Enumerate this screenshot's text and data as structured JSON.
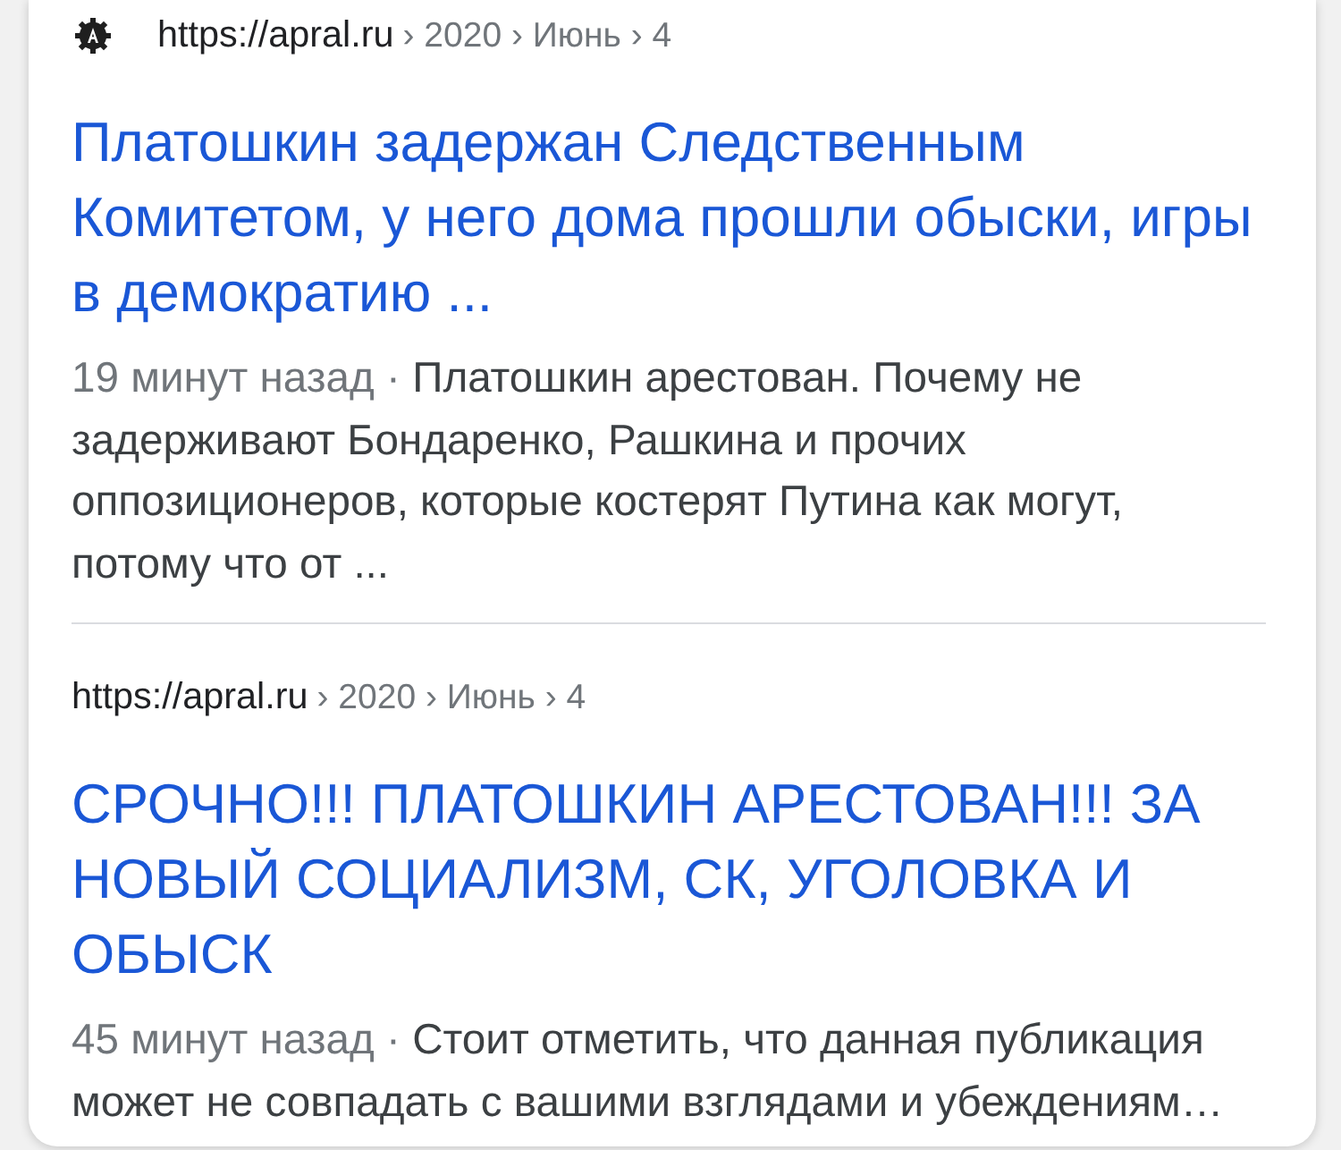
{
  "results": [
    {
      "favicon": true,
      "url": "https://apral.ru",
      "path": "› 2020 › Июнь › 4",
      "title": "Платошкин задержан Следственным Комитетом, у него дома прошли обыски, игры в демократию ...",
      "date": "19 минут назад ·",
      "snippet": "Платошкин арестован. Почему не задерживают Бондаренко, Рашкина и прочих оппозиционеров, которые костерят Путина как могут, потому что от ..."
    },
    {
      "favicon": false,
      "url": "https://apral.ru",
      "path": "› 2020 › Июнь › 4",
      "title": "СРОЧНО!!! ПЛАТОШКИН АРЕСТОВАН!!! ЗА НОВЫЙ СОЦИАЛИЗМ, СК, УГОЛОВКА И ОБЫСК",
      "date": "45 минут назад ·",
      "snippet": "Стоит отметить, что данная публикация может не совпадать с вашими взглядами и убеждениям…"
    }
  ]
}
